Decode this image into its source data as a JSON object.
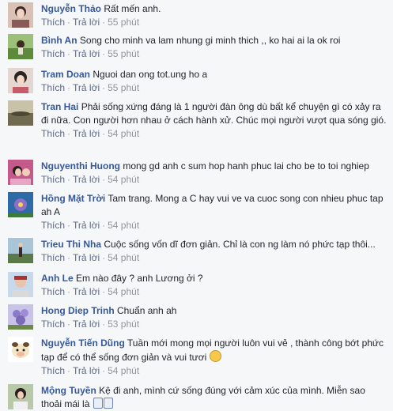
{
  "actions": {
    "like": "Thích",
    "reply": "Trả lời",
    "sep": "·"
  },
  "comments": [
    {
      "name": "Nguyễn Thảo",
      "text": "Rất mến anh.",
      "time": "55 phút"
    },
    {
      "name": "Bình An",
      "text": "Song cho minh va lam nhung gi minh thich ,, ko hai ai la ok roi",
      "time": "55 phút"
    },
    {
      "name": "Tram Doan",
      "text": "Nguoi dan ong tot.ung ho a",
      "time": "55 phút"
    },
    {
      "name": "Tran Hai",
      "text": "Phải sống xứng đáng là 1 người đàn ông dù bất kể chuyện gì có xảy ra đi nữa. Con người hơn nhau ở cách hành xử. Chúc mọi người vượt qua sóng gió.",
      "time": "54 phút"
    },
    {
      "name": "Nguyenthi Huong",
      "text": "mong gd anh c sum hop hanh phuc lai cho be to toi nghiep",
      "time": "54 phút"
    },
    {
      "name": "Hồng Mặt Trời",
      "text": "Tam trang. Mong a C hay vui ve va cuoc song con nhieu phuc tap ah A",
      "time": "54 phút"
    },
    {
      "name": "Trieu Thi Nha",
      "text": "Cuộc sống vốn dĩ đơn giản. Chỉ là con ng làm nó phức tạp thôi...",
      "time": "54 phút"
    },
    {
      "name": "Anh Le",
      "text": "Em nào đây ? anh Lương ởi ?",
      "time": "54 phút"
    },
    {
      "name": "Hong Diep Trinh",
      "text": "Chuẩn anh ah",
      "time": "53 phút"
    },
    {
      "name": "Nguyễn Tiến Dũng",
      "text": "Tuần mới mong mọi người luôn vui vẻ , thành công bớt phức tạp để có thể sống đơn giản và vui tươi",
      "time": "54 phút"
    },
    {
      "name": "Mộng Tuyền",
      "text": "Kệ đi anh, mình cứ sống đúng với cảm xúc của mình. Miễn sao thoải mái là",
      "time": ""
    }
  ],
  "colors": {
    "name": "#365899",
    "meta": "#90949c",
    "background": "#f6f7f9"
  }
}
